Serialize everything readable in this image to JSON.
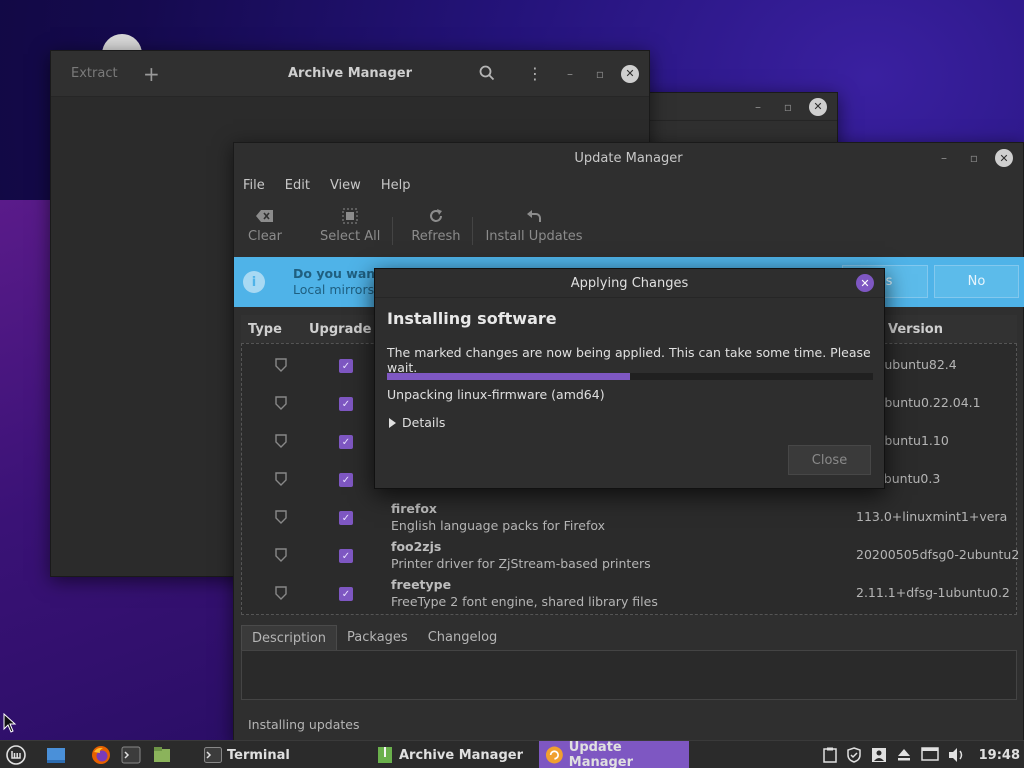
{
  "archive_manager": {
    "title": "Archive Manager",
    "extract_label": "Extract"
  },
  "update_manager": {
    "title": "Update Manager",
    "menu": [
      "File",
      "Edit",
      "View",
      "Help"
    ],
    "toolbar": {
      "clear": "Clear",
      "select_all": "Select All",
      "refresh": "Refresh",
      "install_updates": "Install Updates"
    },
    "infobar": {
      "title": "Do you want to",
      "subtitle": "Local mirrors a",
      "yes_label": "es",
      "no_label": "No"
    },
    "columns": {
      "type": "Type",
      "upgrade": "Upgrade",
      "version": "Version"
    },
    "rows": [
      {
        "name": "",
        "desc": "",
        "version": "11-0ubuntu82.4"
      },
      {
        "name": "",
        "desc": "",
        "version": "1-1ubuntu0.22.04.1"
      },
      {
        "name": "",
        "desc": "",
        "version": "0-1ubuntu1.10"
      },
      {
        "name": "",
        "desc": "",
        "version": "1.1ubuntu0.3"
      },
      {
        "name": "firefox",
        "desc": "English language packs for Firefox",
        "version": "113.0+linuxmint1+vera"
      },
      {
        "name": "foo2zjs",
        "desc": "Printer driver for ZjStream-based printers",
        "version": "20200505dfsg0-2ubuntu2"
      },
      {
        "name": "freetype",
        "desc": "FreeType 2 font engine, shared library files",
        "version": "2.11.1+dfsg-1ubuntu0.2"
      }
    ],
    "tabs": [
      "Description",
      "Packages",
      "Changelog"
    ],
    "status": "Installing updates"
  },
  "dialog": {
    "title": "Applying Changes",
    "heading": "Installing software",
    "message": "The marked changes are now being applied. This can take some time. Please wait.",
    "progress": 0.5,
    "status": "Unpacking linux-firmware (amd64)",
    "details_label": "Details",
    "close_label": "Close"
  },
  "taskbar": {
    "tasks": {
      "terminal": "Terminal",
      "archive": "Archive Manager",
      "update": "Update Manager"
    },
    "clock": "19:48"
  },
  "colors": {
    "accent": "#7e57c2",
    "info_bar": "#4fb3e8"
  }
}
